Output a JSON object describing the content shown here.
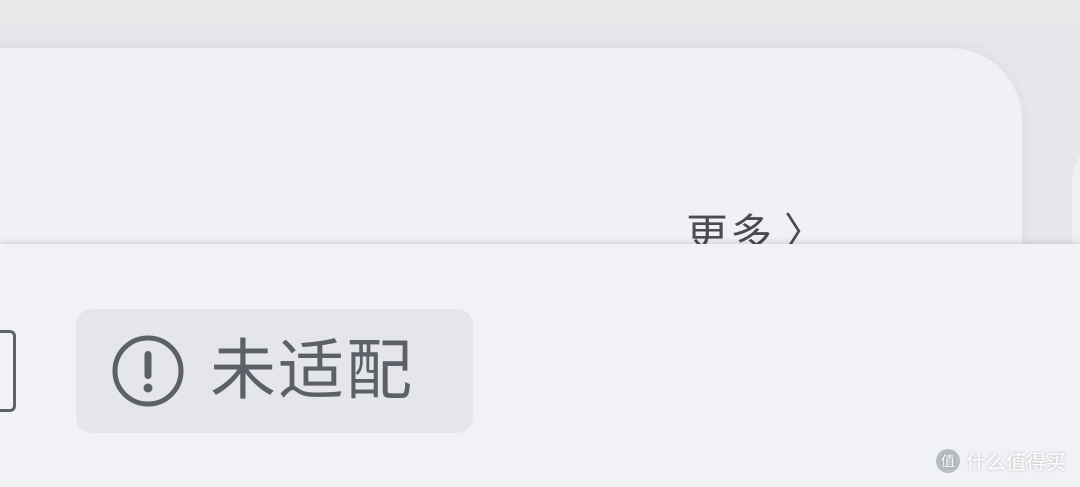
{
  "card": {
    "more_label": "更多",
    "more_chevron": "〉"
  },
  "chip": {
    "label": "未适配",
    "icon": "exclamation-circle-icon"
  },
  "colors": {
    "chip_bg": "#e4e6ea",
    "chip_text": "#5d6068",
    "sheet_bg": "#f1f2f6"
  },
  "watermark": {
    "logo_text": "值",
    "text": "什么值得买"
  }
}
